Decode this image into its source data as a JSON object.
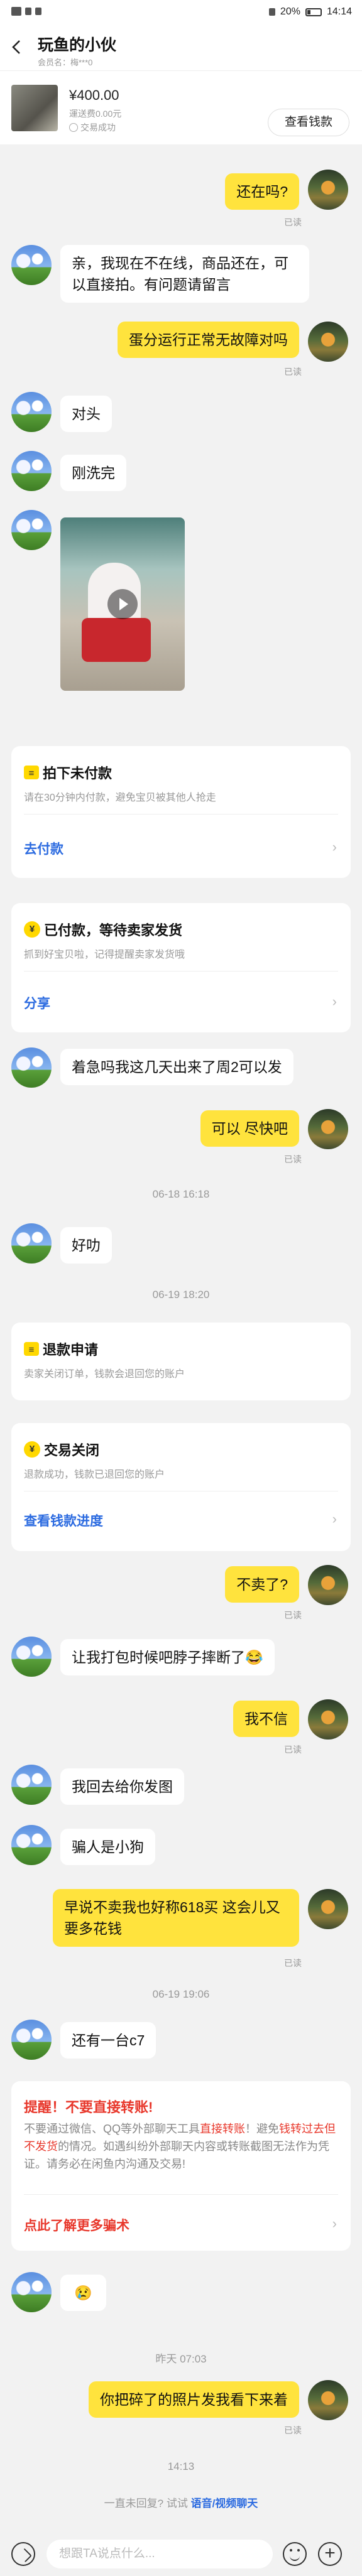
{
  "status": {
    "left_icons": [
      "wechat-icon",
      "bell-icon",
      "signal-icon"
    ],
    "battery": "20%",
    "time": "14:14"
  },
  "header": {
    "title": "玩鱼的小伙",
    "subtitle": "会员名：梅***0"
  },
  "product": {
    "price": "¥400.00",
    "shipping": "運送费0.00元",
    "status": "交易成功",
    "view_button": "查看钱款"
  },
  "messages": {
    "m1": "还在吗?",
    "m2": "亲，我现在不在线，商品还在，可以直接拍。有问题请留言",
    "m3": "蛋分运行正常无故障对吗",
    "m4": "对头",
    "m5": "刚洗完",
    "m6": "着急吗我这几天出来了周2可以发",
    "m7": "可以 尽快吧",
    "m8": "好叻",
    "m9": "不卖了?",
    "m10": "让我打包时候吧脖子摔断了😂",
    "m11": "我不信",
    "m12": "我回去给你发图",
    "m13": "骗人是小狗",
    "m14": "早说不卖我也好称618买 这会儿又要多花钱",
    "m15": "还有一台c7",
    "m16": "😢",
    "m17": "你把碎了的照片发我看下来着",
    "read": "已读"
  },
  "times": {
    "t1": "06-18 16:18",
    "t2": "06-19 18:20",
    "t3": "06-19 19:06",
    "t4": "昨天 07:03",
    "t5": "14:13"
  },
  "cards": {
    "unpaid": {
      "title": "拍下未付款",
      "sub": "请在30分钟内付款，避免宝贝被其他人抢走",
      "link": "去付款"
    },
    "paid": {
      "title": "已付款，等待卖家发货",
      "sub": "抓到好宝贝啦，记得提醒卖家发货哦",
      "link": "分享"
    },
    "refund": {
      "title": "退款申请",
      "sub": "卖家关闭订单，钱款会退回您的账户"
    },
    "closed": {
      "title": "交易关闭",
      "sub": "退款成功，钱款已退回您的账户",
      "link": "查看钱款进度"
    },
    "warning": {
      "title_red": "提醒！不要直接转账!",
      "body_1": "不要通过微信、QQ等外部聊天工具",
      "body_2": "直接转账",
      "body_3": "！避免",
      "body_4": "钱转过去但不发货",
      "body_5": "的情况。如遇纠纷外部聊天内容或转账截图无法作为凭证。请务必在闲鱼内沟通及交易!",
      "link": "点此了解更多骗术"
    }
  },
  "bottom": {
    "hint_prefix": "一直未回复? 试试 ",
    "hint_link": "语音/视频聊天",
    "input_placeholder": "想跟TA说点什么..."
  }
}
